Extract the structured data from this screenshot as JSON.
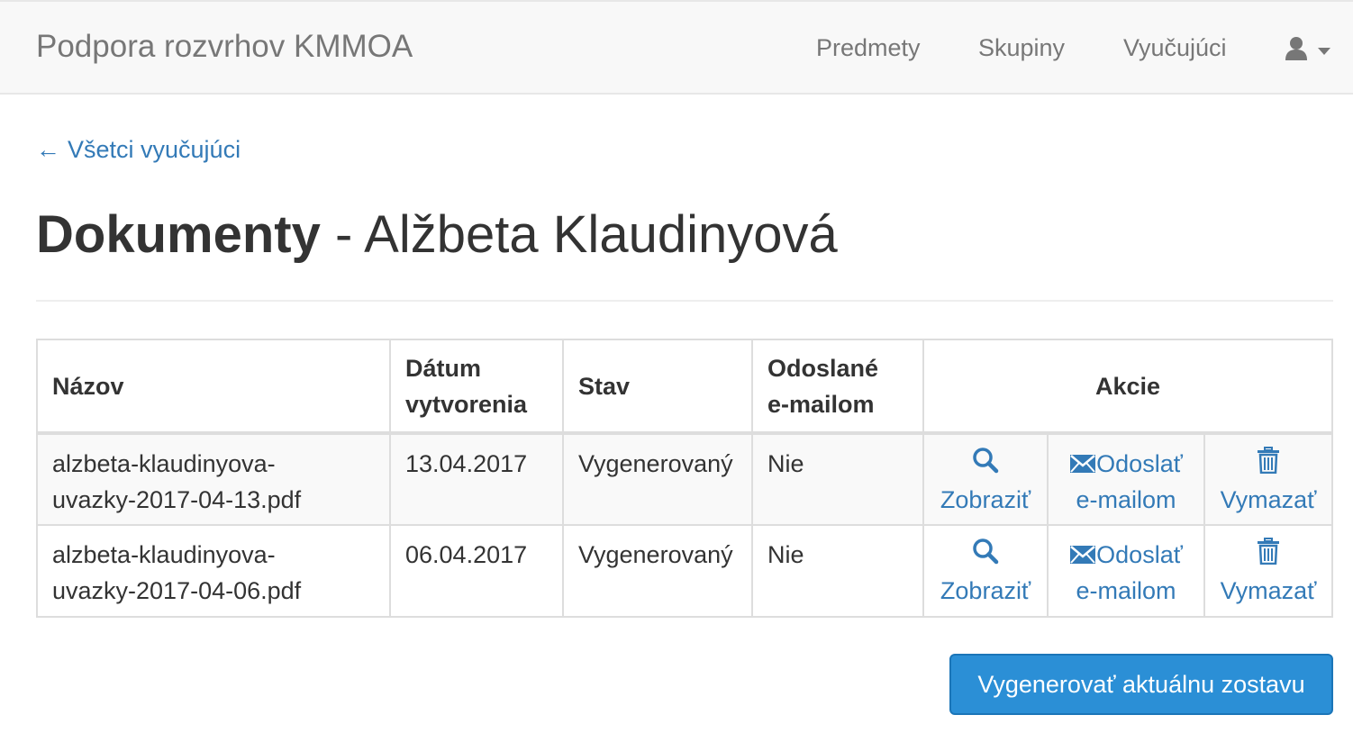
{
  "navbar": {
    "brand": "Podpora rozvrhov KMMOA",
    "links": [
      "Predmety",
      "Skupiny",
      "Vyučujúci"
    ],
    "user_icon": "user-icon",
    "caret_icon": "caret-down-icon"
  },
  "back_link": {
    "arrow": "←",
    "label": "Všetci vyučujúci"
  },
  "page": {
    "title_bold": "Dokumenty",
    "title_separator": " - ",
    "title_name": "Alžbeta Klaudinyová"
  },
  "table": {
    "headers": {
      "name": "Názov",
      "date_line1": "Dátum",
      "date_line2": "vytvorenia",
      "status": "Stav",
      "sent_line1": "Odoslané",
      "sent_line2": "e-mailom",
      "actions": "Akcie"
    },
    "rows": [
      {
        "name_line1": "alzbeta-klaudinyova-",
        "name_line2": "uvazky-2017-04-13.pdf",
        "date": "13.04.2017",
        "status": "Vygenerovaný",
        "sent": "Nie"
      },
      {
        "name_line1": "alzbeta-klaudinyova-",
        "name_line2": "uvazky-2017-04-06.pdf",
        "date": "06.04.2017",
        "status": "Vygenerovaný",
        "sent": "Nie"
      }
    ],
    "actions": {
      "view": "Zobraziť",
      "send_line1": "Odoslať",
      "send_line2": "e-mailom",
      "delete": "Vymazať"
    }
  },
  "generate_button": "Vygenerovať aktuálnu zostavu",
  "colors": {
    "link": "#337ab7",
    "primary": "#2b8fd6",
    "navbar_bg": "#f8f8f8",
    "text": "#333333"
  }
}
